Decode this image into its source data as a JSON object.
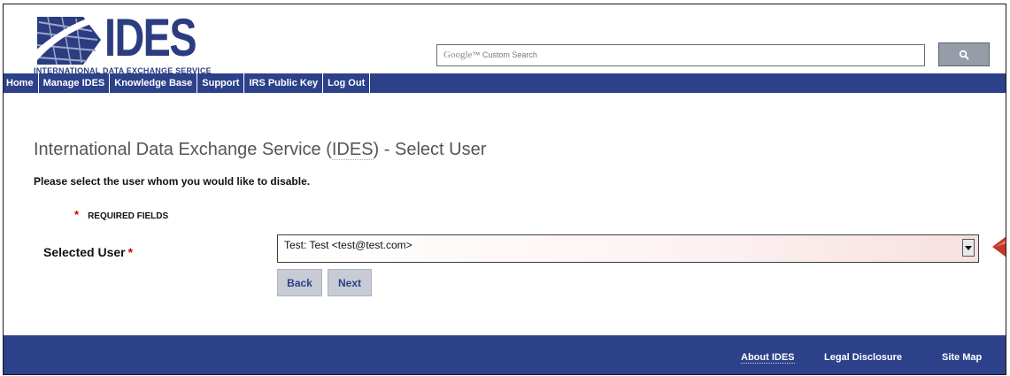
{
  "header": {
    "logo_text": "IDES",
    "logo_subtitle": "INTERNATIONAL DATA EXCHANGE SERVICE",
    "search": {
      "brand": "Google",
      "suffix": "™ Custom Search",
      "button_icon": "search-icon"
    }
  },
  "nav": {
    "items": [
      {
        "label": "Home"
      },
      {
        "label": "Manage IDES"
      },
      {
        "label": "Knowledge Base"
      },
      {
        "label": "Support"
      },
      {
        "label": "IRS Public Key"
      },
      {
        "label": "Log Out"
      }
    ]
  },
  "main": {
    "title_prefix": "International Data Exchange Service (",
    "title_abbr": "IDES",
    "title_suffix": ") - Select User",
    "instruction": "Please select the user whom you would like to disable.",
    "required_star": "*",
    "required_text": "REQUIRED FIELDS",
    "field_label": "Selected User",
    "field_star": "*",
    "selected_user": "Test: Test <test@test.com>",
    "back_label": "Back",
    "next_label": "Next"
  },
  "footer": {
    "links": [
      {
        "label": "About IDES"
      },
      {
        "label": "Legal Disclosure"
      },
      {
        "label": "Site Map"
      }
    ]
  },
  "colors": {
    "brand_blue": "#2c4189",
    "required_red": "#cc0000",
    "marker_red": "#c0392b"
  }
}
